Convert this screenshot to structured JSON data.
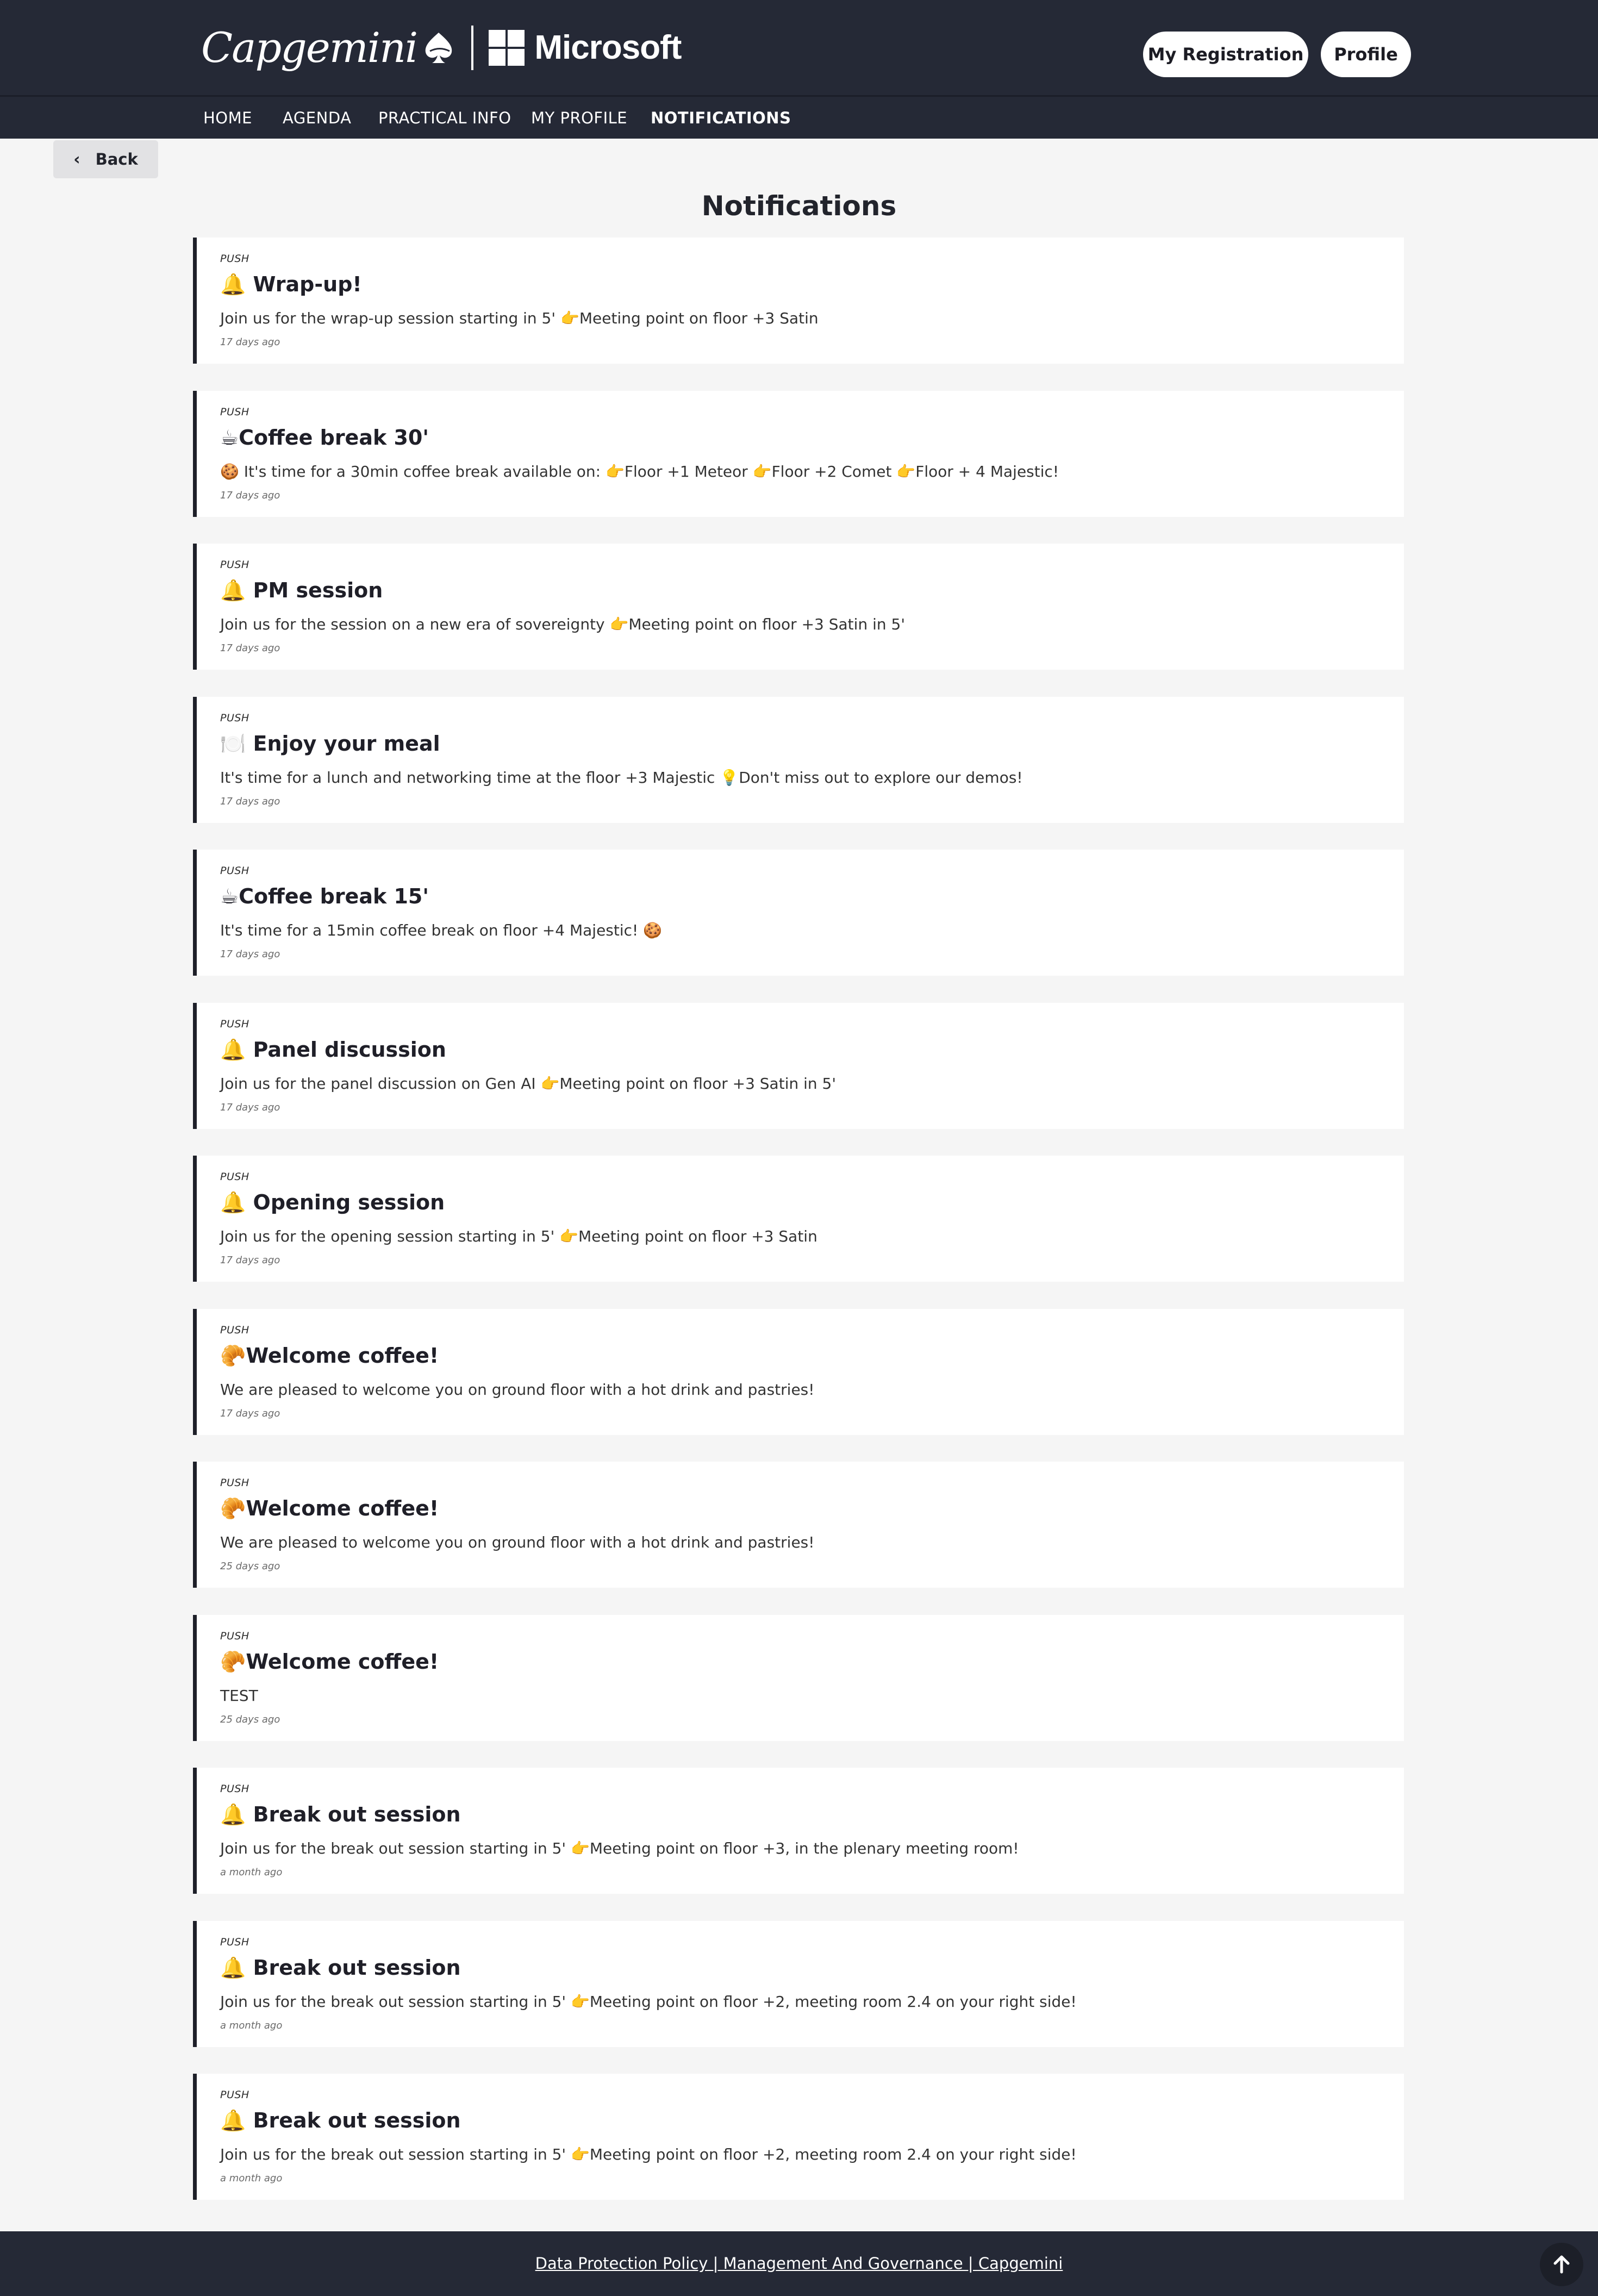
{
  "header": {
    "brand_left": "Capgemini",
    "brand_right": "Microsoft",
    "registration_button": "My Registration",
    "profile_button": "Profile"
  },
  "nav": {
    "items": [
      {
        "label": "HOME"
      },
      {
        "label": "AGENDA"
      },
      {
        "label": "PRACTICAL INFO"
      },
      {
        "label": "MY PROFILE"
      },
      {
        "label": "NOTIFICATIONS"
      }
    ],
    "active": "NOTIFICATIONS"
  },
  "back_label": "Back",
  "page_title": "Notifications",
  "notifications": [
    {
      "type": "PUSH",
      "title": "🔔 Wrap-up!",
      "body": "Join us for the wrap-up session starting in 5' 👉Meeting point on floor +3 Satin",
      "time": "17 days ago"
    },
    {
      "type": "PUSH",
      "title": "☕Coffee break 30'",
      "body": "🍪 It's time for a 30min coffee break available on: 👉Floor +1 Meteor 👉Floor +2 Comet 👉Floor + 4 Majestic!",
      "time": "17 days ago"
    },
    {
      "type": "PUSH",
      "title": "🔔 PM session",
      "body": "Join us for the session on a new era of sovereignty 👉Meeting point on floor +3 Satin in 5'",
      "time": "17 days ago"
    },
    {
      "type": "PUSH",
      "title": "🍽️ Enjoy your meal",
      "body": "It's time for a lunch and networking time at the floor +3 Majestic 💡Don't miss out to explore our demos!",
      "time": "17 days ago"
    },
    {
      "type": "PUSH",
      "title": "☕Coffee break 15'",
      "body": "It's time for a 15min coffee break on floor +4 Majestic! 🍪",
      "time": "17 days ago"
    },
    {
      "type": "PUSH",
      "title": "🔔 Panel discussion",
      "body": "Join us for the panel discussion on Gen AI 👉Meeting point on floor +3 Satin in 5'",
      "time": "17 days ago"
    },
    {
      "type": "PUSH",
      "title": "🔔 Opening session",
      "body": "Join us for the opening session starting in 5' 👉Meeting point on floor +3 Satin",
      "time": "17 days ago"
    },
    {
      "type": "PUSH",
      "title": "🥐Welcome coffee!",
      "body": "We are pleased to welcome you on ground floor with a hot drink and pastries!",
      "time": "17 days ago"
    },
    {
      "type": "PUSH",
      "title": "🥐Welcome coffee!",
      "body": "We are pleased to welcome you on ground floor with a hot drink and pastries!",
      "time": "25 days ago"
    },
    {
      "type": "PUSH",
      "title": "🥐Welcome coffee!",
      "body": "TEST",
      "time": "25 days ago"
    },
    {
      "type": "PUSH",
      "title": "🔔 Break out session",
      "body": "Join us for the break out session starting in 5' 👉Meeting point on floor +3, in the plenary meeting room!",
      "time": "a month ago"
    },
    {
      "type": "PUSH",
      "title": "🔔 Break out session",
      "body": "Join us for the break out session starting in 5' 👉Meeting point on floor +2, meeting room 2.4 on your right side!",
      "time": "a month ago"
    },
    {
      "type": "PUSH",
      "title": "🔔 Break out session",
      "body": "Join us for the break out session starting in 5' 👉Meeting point on floor +2, meeting room 2.4 on your right side!",
      "time": "a month ago"
    }
  ],
  "footer": {
    "link": "Data Protection Policy | Management And Governance | Capgemini"
  },
  "icons": {
    "logo_spade": "spade-icon",
    "windows_logo": "windows-logo-icon",
    "back": "chevron-left-icon",
    "scroll_top": "arrow-up-icon"
  },
  "colors": {
    "header_bg": "#252936",
    "page_bg": "#f5f5f5",
    "card_accent": "#1e2029"
  }
}
